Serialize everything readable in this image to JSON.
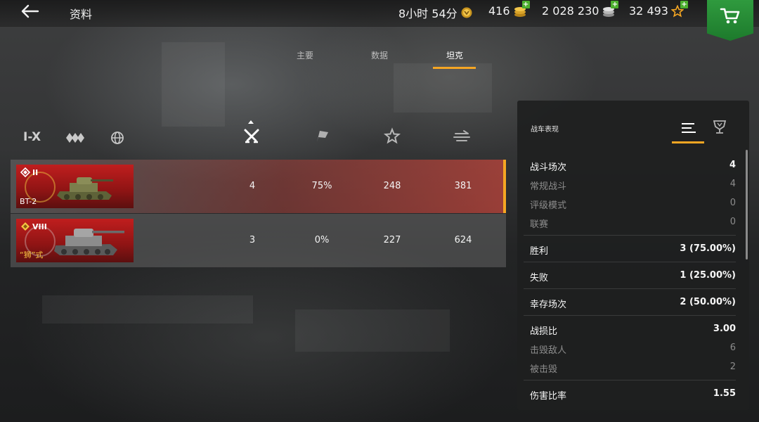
{
  "header": {
    "title": "资料",
    "resources": [
      {
        "name": "premium-time",
        "value": "8小时 54分",
        "icon": "premium-time-icon",
        "has_plus": false
      },
      {
        "name": "gold",
        "value": "416",
        "icon": "gold-coins-icon",
        "has_plus": true
      },
      {
        "name": "credits",
        "value": "2 028 230",
        "icon": "silver-coins-icon",
        "has_plus": true
      },
      {
        "name": "free-xp",
        "value": "32 493",
        "icon": "free-xp-star-icon",
        "has_plus": true
      }
    ],
    "shop_icon": "cart-icon"
  },
  "tabs": [
    {
      "label": "主要",
      "active": false
    },
    {
      "label": "数据",
      "active": false
    },
    {
      "label": "坦克",
      "active": true
    }
  ],
  "filters": {
    "tier_label": "I-X",
    "type_icon": "vehicle-class-icon",
    "nation_icon": "globe-icon"
  },
  "columns": [
    {
      "icon": "crossed-swords-icon",
      "meaning": "battles",
      "sorted": true
    },
    {
      "icon": "victory-flag-icon",
      "meaning": "win-rate"
    },
    {
      "icon": "star-icon",
      "meaning": "avg-xp"
    },
    {
      "icon": "damage-icon",
      "meaning": "avg-damage"
    }
  ],
  "tanks": [
    {
      "tier": "II",
      "name": "BT-2",
      "premium": false,
      "battles": "4",
      "winrate": "75%",
      "xp": "248",
      "damage": "381",
      "selected": true
    },
    {
      "tier": "VIII",
      "name": "“狮”式",
      "premium": true,
      "battles": "3",
      "winrate": "0%",
      "xp": "227",
      "damage": "624",
      "selected": false
    }
  ],
  "panel": {
    "title": "战车表现",
    "tabs": [
      "list-icon",
      "trophy-icon"
    ],
    "groups": [
      [
        {
          "label": "战斗场次",
          "value": "4",
          "style": "main"
        },
        {
          "label": "常规战斗",
          "value": "4",
          "style": "sub"
        },
        {
          "label": "评级模式",
          "value": "0",
          "style": "sub"
        },
        {
          "label": "联赛",
          "value": "0",
          "style": "sub"
        }
      ],
      [
        {
          "label": "胜利",
          "value": "3 (75.00%)",
          "style": "main"
        }
      ],
      [
        {
          "label": "失败",
          "value": "1 (25.00%)",
          "style": "main"
        }
      ],
      [
        {
          "label": "幸存场次",
          "value": "2 (50.00%)",
          "style": "main"
        }
      ],
      [
        {
          "label": "战损比",
          "value": "3.00",
          "style": "main"
        },
        {
          "label": "击毁敌人",
          "value": "6",
          "style": "sub"
        },
        {
          "label": "被击毁",
          "value": "2",
          "style": "sub"
        }
      ],
      [
        {
          "label": "伤害比率",
          "value": "1.55",
          "style": "main"
        }
      ]
    ]
  },
  "colors": {
    "accent": "#f5a623",
    "shop_green": "#2f9a3e",
    "selected_row_red": "#c8463c"
  }
}
